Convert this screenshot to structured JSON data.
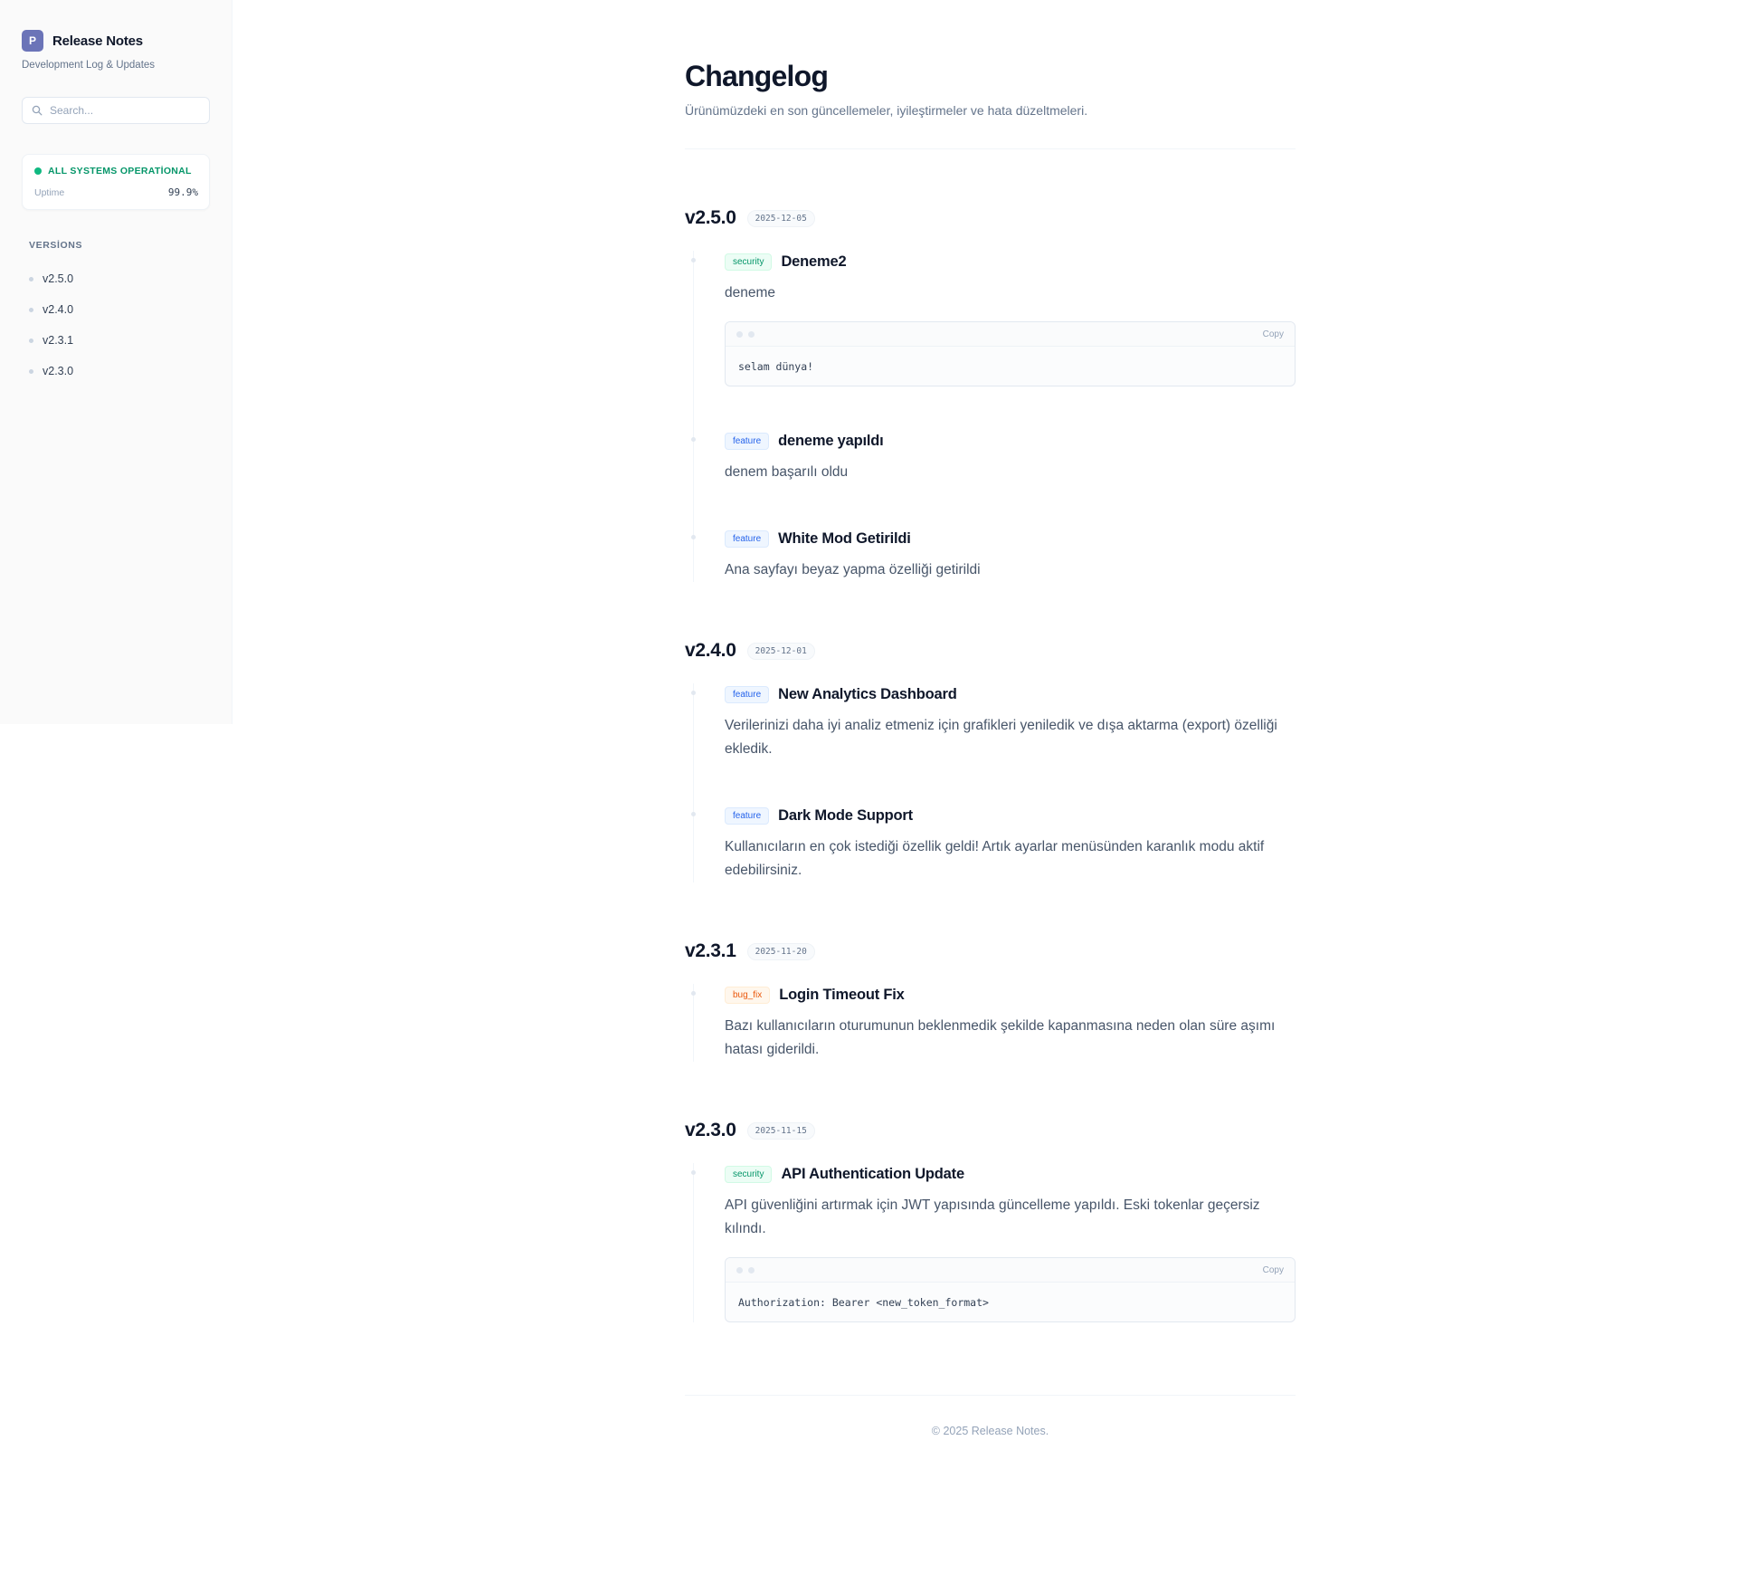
{
  "sidebar": {
    "logo_letter": "P",
    "title": "Release Notes",
    "subtitle": "Development Log & Updates",
    "search_placeholder": "Search...",
    "status": {
      "label": "ALL SYSTEMS OPERATİONAL",
      "uptime_label": "Uptime",
      "uptime_value": "99.9%"
    },
    "versions_heading": "VERSİONS",
    "versions": [
      "v2.5.0",
      "v2.4.0",
      "v2.3.1",
      "v2.3.0"
    ]
  },
  "main": {
    "title": "Changelog",
    "subtitle": "Ürünümüzdeki en son güncellemeler, iyileştirmeler ve hata düzeltmeleri.",
    "releases": [
      {
        "version": "v2.5.0",
        "date": "2025-12-05",
        "entries": [
          {
            "tag": "security",
            "title": "Deneme2",
            "desc": "deneme",
            "code": "selam dünya!",
            "copy": "Copy"
          },
          {
            "tag": "feature",
            "title": "deneme yapıldı",
            "desc": "denem başarılı oldu"
          },
          {
            "tag": "feature",
            "title": "White Mod Getirildi",
            "desc": "Ana sayfayı beyaz yapma özelliği getirildi"
          }
        ]
      },
      {
        "version": "v2.4.0",
        "date": "2025-12-01",
        "entries": [
          {
            "tag": "feature",
            "title": "New Analytics Dashboard",
            "desc": "Verilerinizi daha iyi analiz etmeniz için grafikleri yeniledik ve dışa aktarma (export) özelliği ekledik."
          },
          {
            "tag": "feature",
            "title": "Dark Mode Support",
            "desc": "Kullanıcıların en çok istediği özellik geldi! Artık ayarlar menüsünden karanlık modu aktif edebilirsiniz."
          }
        ]
      },
      {
        "version": "v2.3.1",
        "date": "2025-11-20",
        "entries": [
          {
            "tag": "bug_fix",
            "title": "Login Timeout Fix",
            "desc": "Bazı kullanıcıların oturumunun beklenmedik şekilde kapanmasına neden olan süre aşımı hatası giderildi."
          }
        ]
      },
      {
        "version": "v2.3.0",
        "date": "2025-11-15",
        "entries": [
          {
            "tag": "security",
            "title": "API Authentication Update",
            "desc": "API güvenliğini artırmak için JWT yapısında güncelleme yapıldı. Eski tokenlar geçersiz kılındı.",
            "code": "Authorization: Bearer <new_token_format>",
            "copy": "Copy"
          }
        ]
      }
    ],
    "footer": "© 2025 Release Notes."
  },
  "colors": {
    "accent_logo": "#6b74b8",
    "status_green": "#10b981",
    "tag_security": "#059669",
    "tag_feature": "#2563eb",
    "tag_bug_fix": "#ea580c"
  },
  "icons": {
    "search": "search-icon"
  }
}
